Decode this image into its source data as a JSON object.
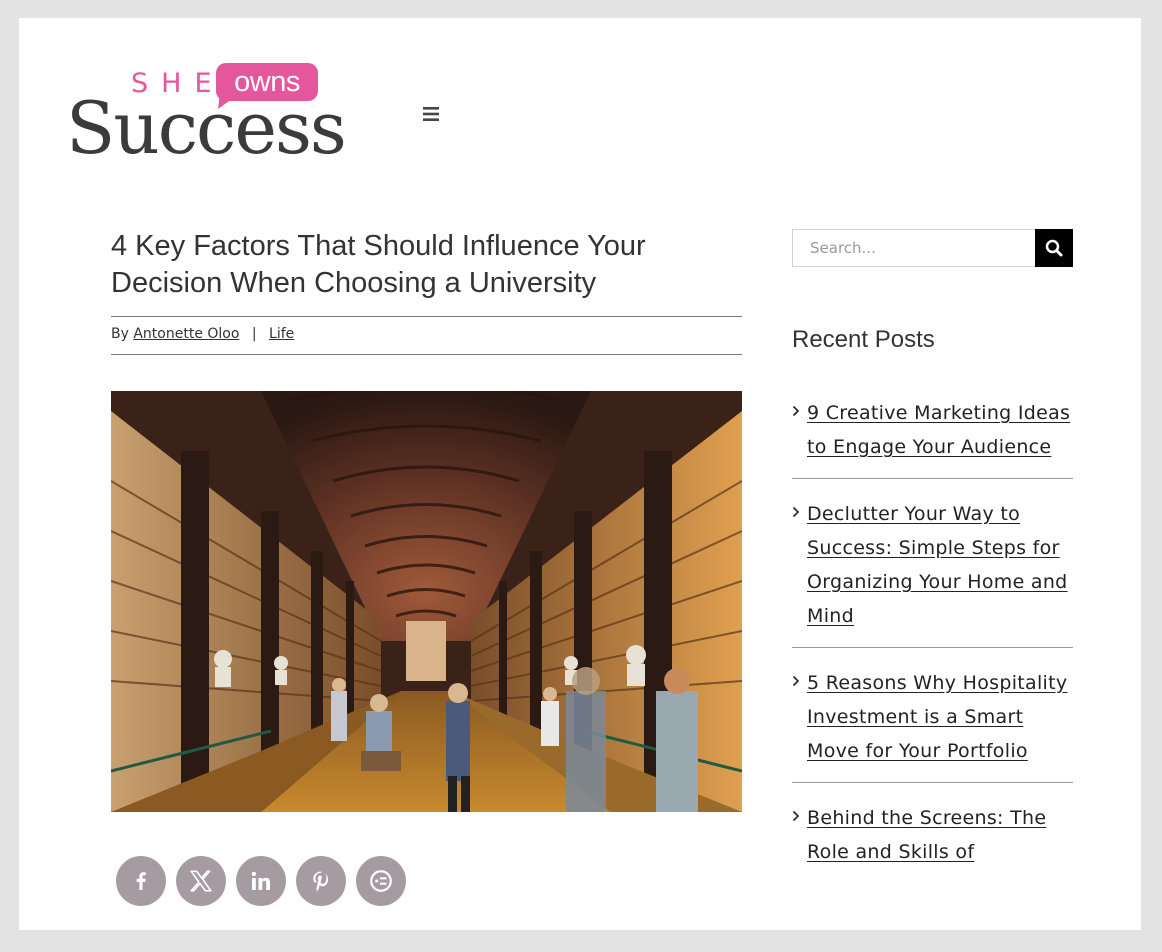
{
  "logo": {
    "she": "SHE",
    "owns": "owns",
    "success": "Success",
    "colors": {
      "pink": "#e4579c",
      "dark": "#3b3b3b"
    }
  },
  "header": {
    "menu_icon": "hamburger-icon"
  },
  "article": {
    "title": "4 Key Factors That Should Influence Your Decision When Choosing a University",
    "by_label": "By",
    "author": "Antonette Oloo",
    "separator": "|",
    "category": "Life",
    "image": "library-hall-photo"
  },
  "share": {
    "icons": [
      "facebook-icon",
      "x-icon",
      "linkedin-icon",
      "pinterest-icon",
      "more-icon"
    ],
    "color": "#a59ba1"
  },
  "sidebar": {
    "search": {
      "placeholder": "Search...",
      "button_icon": "search-icon"
    },
    "recent_heading": "Recent Posts",
    "recent_posts": [
      {
        "title": "9 Creative Marketing Ideas to Engage Your Audience"
      },
      {
        "title": "Declutter Your Way to Success: Simple Steps for Organizing Your Home and Mind"
      },
      {
        "title": "5 Reasons Why Hospitality Investment is a Smart Move for Your Portfolio"
      },
      {
        "title": "Behind the Screens: The Role and Skills of"
      }
    ]
  }
}
